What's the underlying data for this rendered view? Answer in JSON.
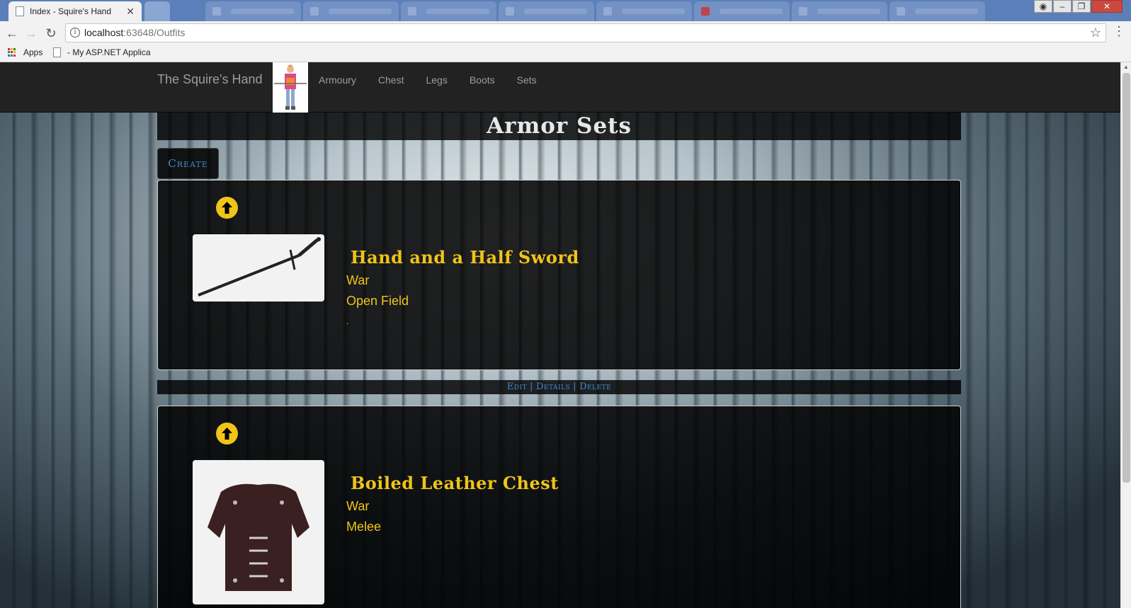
{
  "browser": {
    "active_tab_title": "Index - Squire's Hand",
    "url_host": "localhost",
    "url_rest": ":63648/Outfits",
    "bookmarks": [
      "Apps",
      "- My ASP.NET Applica"
    ]
  },
  "site": {
    "brand": "The Squire's Hand",
    "nav": [
      "Armoury",
      "Chest",
      "Legs",
      "Boots",
      "Sets"
    ]
  },
  "page": {
    "title": "Armor Sets",
    "create_label": "Create",
    "actions": {
      "edit": "Edit",
      "details": "Details",
      "delete": "Delete",
      "separator": "|"
    }
  },
  "items": [
    {
      "name": "Hand and a Half Sword",
      "line1": "War",
      "line2": "Open Field",
      "extra": "."
    },
    {
      "name": "Boiled Leather Chest",
      "line1": "War",
      "line2": "Melee"
    }
  ],
  "colors": {
    "accent_gold": "#f0c419",
    "link_blue": "#3f8bcf",
    "navbar": "#222222"
  }
}
